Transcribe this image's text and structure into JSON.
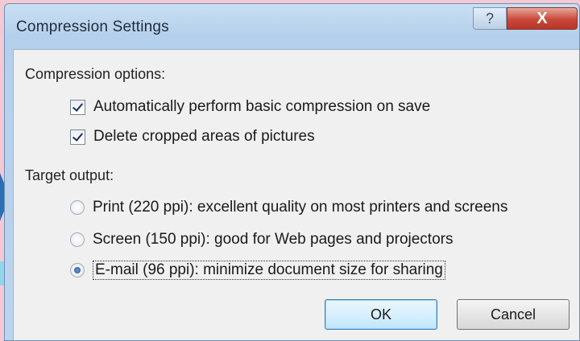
{
  "dialog": {
    "title": "Compression Settings",
    "help_glyph": "?",
    "close_glyph": "X"
  },
  "compression_options": {
    "label": "Compression options:",
    "items": [
      {
        "label": "Automatically perform basic compression on save",
        "checked": true
      },
      {
        "label": "Delete cropped areas of pictures",
        "checked": true
      }
    ]
  },
  "target_output": {
    "label": "Target output:",
    "options": [
      {
        "label": "Print (220 ppi): excellent quality on most printers and screens",
        "selected": false
      },
      {
        "label": "Screen (150 ppi): good for Web pages and projectors",
        "selected": false
      },
      {
        "label": "E-mail (96 ppi): minimize document size for sharing",
        "selected": true
      }
    ]
  },
  "buttons": {
    "ok_label": "OK",
    "cancel_label": "Cancel"
  }
}
